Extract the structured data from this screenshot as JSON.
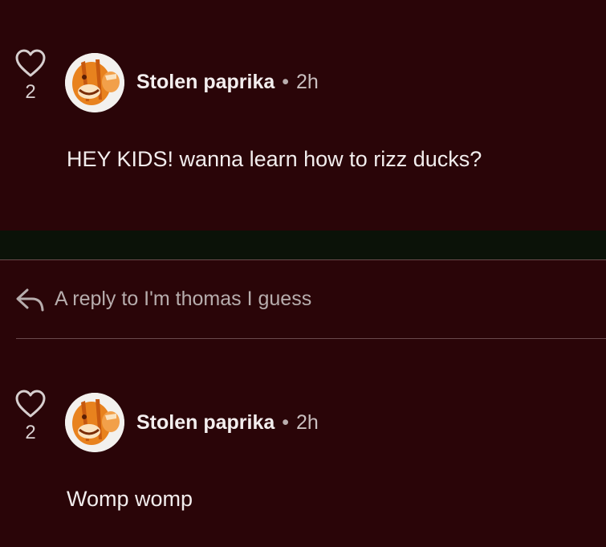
{
  "comments": [
    {
      "likes": "2",
      "author": "Stolen paprika",
      "separator": "•",
      "time": "2h",
      "text": "HEY KIDS! wanna learn how to rizz ducks?"
    },
    {
      "likes": "2",
      "author": "Stolen paprika",
      "separator": "•",
      "time": "2h",
      "text": "Womp womp"
    }
  ],
  "reply": {
    "label": "A reply to I'm thomas I guess"
  },
  "icons": {
    "like": "heart-icon",
    "reply": "reply-arrow-icon",
    "avatar": "avatar"
  },
  "colors": {
    "background": "#2a0508",
    "band": "#0b1208",
    "text": "#f2eded",
    "muted": "#b7adad",
    "avatar_accent": "#e8821e"
  }
}
